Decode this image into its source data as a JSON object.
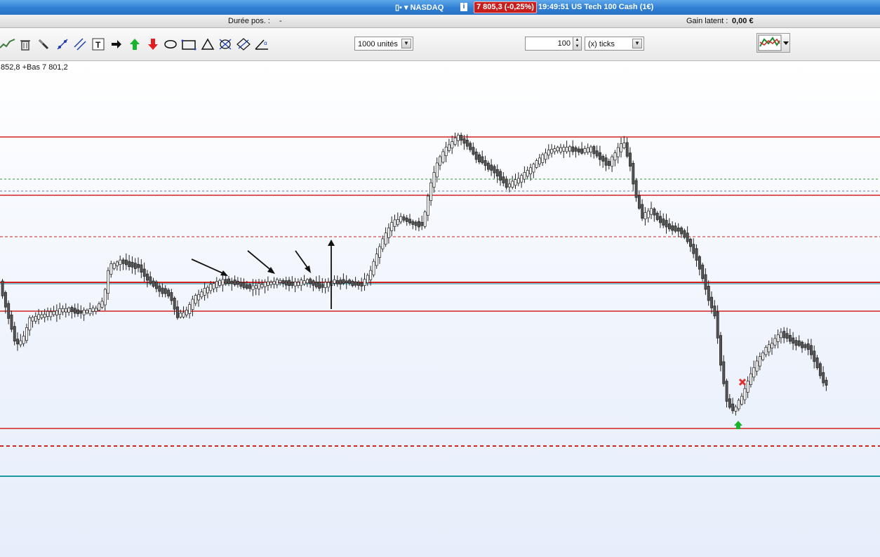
{
  "titlebar": {
    "instrument": "NASDAQ",
    "price": "7 805,3 (-0,25%)",
    "time_title": "19:49:51 US Tech 100 Cash (1€)",
    "info_label": "i"
  },
  "posbar": {
    "duration_label": "Durée pos. :",
    "duration_value": "-",
    "gain_label": "Gain latent :",
    "gain_value": "0,00 €"
  },
  "toolbar": {
    "tools": [
      "trend-line-icon",
      "trash-icon",
      "eraser-icon",
      "line-icon",
      "parallel-lines-icon",
      "text-icon",
      "arrow-right-icon",
      "arrow-up-green-icon",
      "arrow-down-red-icon",
      "lasso-icon",
      "rectangle-icon",
      "triangle-icon",
      "ellipse-icon",
      "fibonacci-icon",
      "angle-icon"
    ],
    "units_select": "1000 unités",
    "ticks_input": "100",
    "ticks_select": "(x) ticks"
  },
  "chart": {
    "ohlc_label": "852,8 +Bas 7 801,2",
    "colors": {
      "support_line": "#d32222",
      "green_dashed": "#2e9b3a",
      "blue_dashed": "#5a6fb0",
      "teal_line": "#1a9aa0",
      "bear_candle": "#555555",
      "bull_candle": "#ffffff"
    }
  }
}
